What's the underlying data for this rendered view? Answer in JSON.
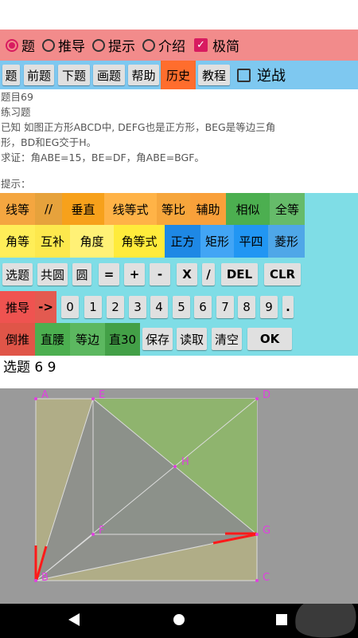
{
  "mode_bar": {
    "items": [
      {
        "label": "题",
        "selected": true
      },
      {
        "label": "推导",
        "selected": false
      },
      {
        "label": "提示",
        "selected": false
      },
      {
        "label": "介绍",
        "selected": false
      }
    ],
    "minimal_label": "极简",
    "minimal_checked": true
  },
  "nav_bar": {
    "buttons": [
      "题",
      "前题",
      "下题",
      "画题",
      "帮助",
      "历史",
      "教程"
    ],
    "active": "历史",
    "reverse_label": "逆战",
    "reverse_checked": false
  },
  "problem": {
    "number": "题目69",
    "type": "练习题",
    "given_line1": "已知 如图正方形ABCD中, DEFG也是正方形，BEG是等边三角",
    "given_line2": "形，BD和EG交于H。",
    "prove": "求证：角ABE=15，BE=DF，角ABE=BGF。",
    "hint_label": "提示："
  },
  "keypad": {
    "row1": [
      "线等",
      "//",
      "垂直",
      "线等式",
      "等比",
      "辅助",
      "相似",
      "全等"
    ],
    "row2": [
      "角等",
      "互补",
      "角度",
      "角等式",
      "正方",
      "矩形",
      "平四",
      "菱形"
    ],
    "row3": [
      "选题",
      "共圆",
      "圆",
      "=",
      "+",
      "-",
      "X",
      "/",
      "DEL",
      "CLR"
    ],
    "row4": [
      "推导",
      "->",
      "0",
      "1",
      "2",
      "3",
      "4",
      "5",
      "6",
      "7",
      "8",
      "9",
      "."
    ],
    "row5": [
      "倒推",
      "直腰",
      "等边",
      "直30",
      "保存",
      "读取",
      "清空",
      "OK"
    ]
  },
  "output": {
    "text": "选题 6 9"
  },
  "diagram": {
    "points": [
      "A",
      "E",
      "D",
      "H",
      "F",
      "G",
      "B",
      "C"
    ]
  },
  "colors": {
    "mode_bar": "#f28b8b",
    "nav_bar": "#7ec8f0",
    "active_tab": "#ff6d2d",
    "keypad_bg": "#7fdde6",
    "accent": "#d81b60",
    "point_label": "#e040e0"
  }
}
